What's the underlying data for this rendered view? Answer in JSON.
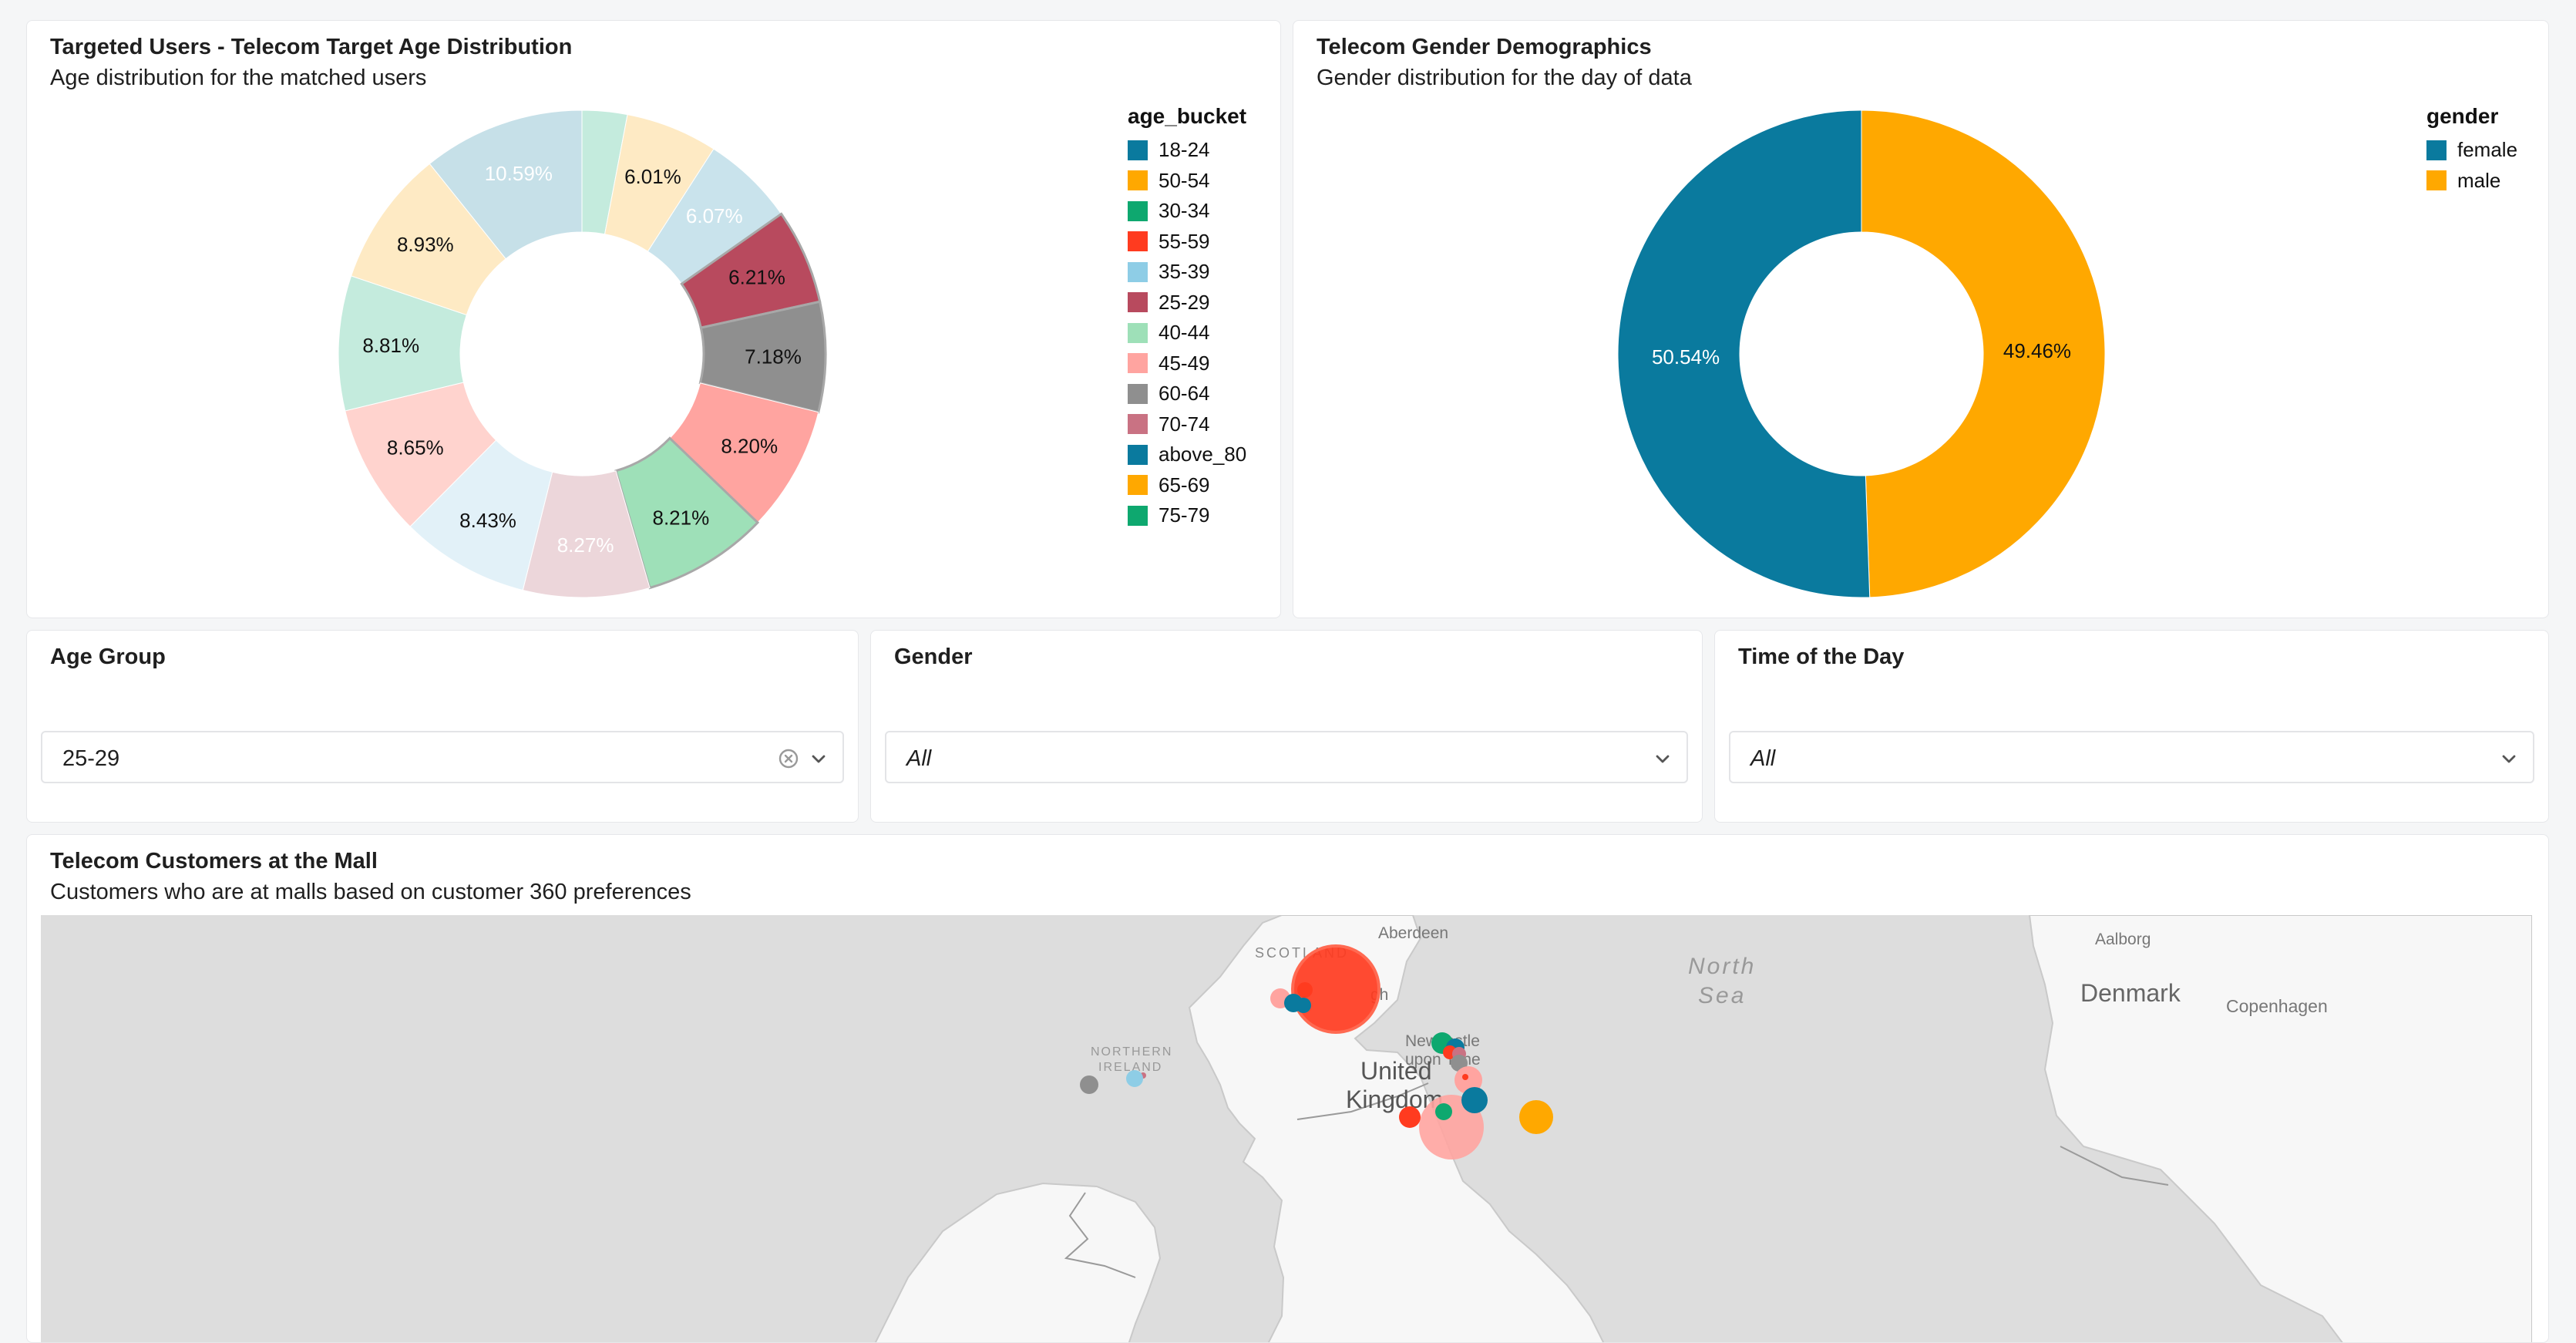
{
  "age_panel": {
    "title": "Targeted Users - Telecom Target Age Distribution",
    "subtitle": "Age distribution for the matched users",
    "legend_title": "age_bucket",
    "legend": [
      {
        "label": "18-24",
        "color": "#0a7a9e"
      },
      {
        "label": "50-54",
        "color": "#ffa800"
      },
      {
        "label": "30-34",
        "color": "#0ea86f"
      },
      {
        "label": "55-59",
        "color": "#ff3b1f"
      },
      {
        "label": "35-39",
        "color": "#8ecde6"
      },
      {
        "label": "25-29",
        "color": "#b84a5e"
      },
      {
        "label": "40-44",
        "color": "#9ee0b8"
      },
      {
        "label": "45-49",
        "color": "#ffa4a0"
      },
      {
        "label": "60-64",
        "color": "#8f8f8f"
      },
      {
        "label": "70-74",
        "color": "#c97283"
      },
      {
        "label": "above_80",
        "color": "#0a7a9e"
      },
      {
        "label": "65-69",
        "color": "#ffa800"
      },
      {
        "label": "75-79",
        "color": "#0ea86f"
      }
    ]
  },
  "gender_panel": {
    "title": "Telecom Gender Demographics",
    "subtitle": "Gender distribution for the day of data",
    "legend_title": "gender",
    "legend": [
      {
        "label": "female",
        "color": "#0a7a9e"
      },
      {
        "label": "male",
        "color": "#ffa800"
      }
    ]
  },
  "filters": {
    "age_group": {
      "label": "Age Group",
      "value": "25-29"
    },
    "gender": {
      "label": "Gender",
      "value": "All"
    },
    "time_of_day": {
      "label": "Time of the Day",
      "value": "All"
    }
  },
  "map_panel": {
    "title": "Telecom Customers at the Mall",
    "subtitle": "Customers who are at malls based on customer 360 preferences",
    "labels": {
      "aberdeen": "Aberdeen",
      "scotland": "SCOTLAND",
      "north_sea_1": "North",
      "north_sea_2": "Sea",
      "aalborg": "Aalborg",
      "denmark": "Denmark",
      "copenhagen": "Copenhagen",
      "edinburgh_frag": "gh",
      "newcastle_1": "Newcastle",
      "newcastle_2": "upon Tyne",
      "ni_1": "NORTHERN",
      "ni_2": "IRELAND",
      "uk_1": "United",
      "uk_2": "Kingdom"
    },
    "marker_colors": {
      "red": "#ff3b1f",
      "pink": "#ffa4a0",
      "blue": "#0a7a9e",
      "green": "#0ea86f",
      "grey": "#8f8f8f",
      "light_blue": "#8ecde6",
      "yellow": "#ffa800",
      "rose": "#c97283"
    }
  },
  "chart_data": [
    {
      "type": "pie",
      "title": "Targeted Users - Telecom Target Age Distribution",
      "subtitle": "Age distribution for the matched users",
      "legend_title": "age_bucket",
      "legend_position": "right",
      "donut": true,
      "slices": [
        {
          "value": 2.95,
          "label": "",
          "color": "#c4ebdd"
        },
        {
          "value": 6.01,
          "label": "6.01%",
          "color": "#feeac4",
          "text": "#111"
        },
        {
          "value": 6.07,
          "label": "6.07%",
          "color": "#c9e3ec",
          "text": "#fff"
        },
        {
          "value": 6.21,
          "label": "6.21%",
          "color": "#b84a5e",
          "text": "#111",
          "stroke": true
        },
        {
          "value": 7.18,
          "label": "7.18%",
          "color": "#8f8f8f",
          "text": "#111",
          "stroke": true
        },
        {
          "value": 8.2,
          "label": "8.20%",
          "color": "#ffa4a0",
          "text": "#111"
        },
        {
          "value": 8.21,
          "label": "8.21%",
          "color": "#9ee0b8",
          "text": "#111",
          "stroke": true
        },
        {
          "value": 8.27,
          "label": "8.27%",
          "color": "#ecd6da",
          "text": "#fff"
        },
        {
          "value": 8.43,
          "label": "8.43%",
          "color": "#e2f1f8",
          "text": "#111"
        },
        {
          "value": 8.65,
          "label": "8.65%",
          "color": "#ffd3ce",
          "text": "#111"
        },
        {
          "value": 8.81,
          "label": "8.81%",
          "color": "#c4ebdd",
          "text": "#111"
        },
        {
          "value": 8.93,
          "label": "8.93%",
          "color": "#feeac4",
          "text": "#111"
        },
        {
          "value": 10.59,
          "label": "10.59%",
          "color": "#c6e0e8",
          "text": "#fff"
        }
      ]
    },
    {
      "type": "pie",
      "title": "Telecom Gender Demographics",
      "subtitle": "Gender distribution for the day of data",
      "legend_title": "gender",
      "legend_position": "right",
      "donut": true,
      "slices": [
        {
          "value": 49.46,
          "label": "49.46%",
          "category": "male",
          "color": "#ffa800",
          "text": "#111"
        },
        {
          "value": 50.54,
          "label": "50.54%",
          "category": "female",
          "color": "#0a7a9e",
          "text": "#fff"
        }
      ]
    }
  ]
}
